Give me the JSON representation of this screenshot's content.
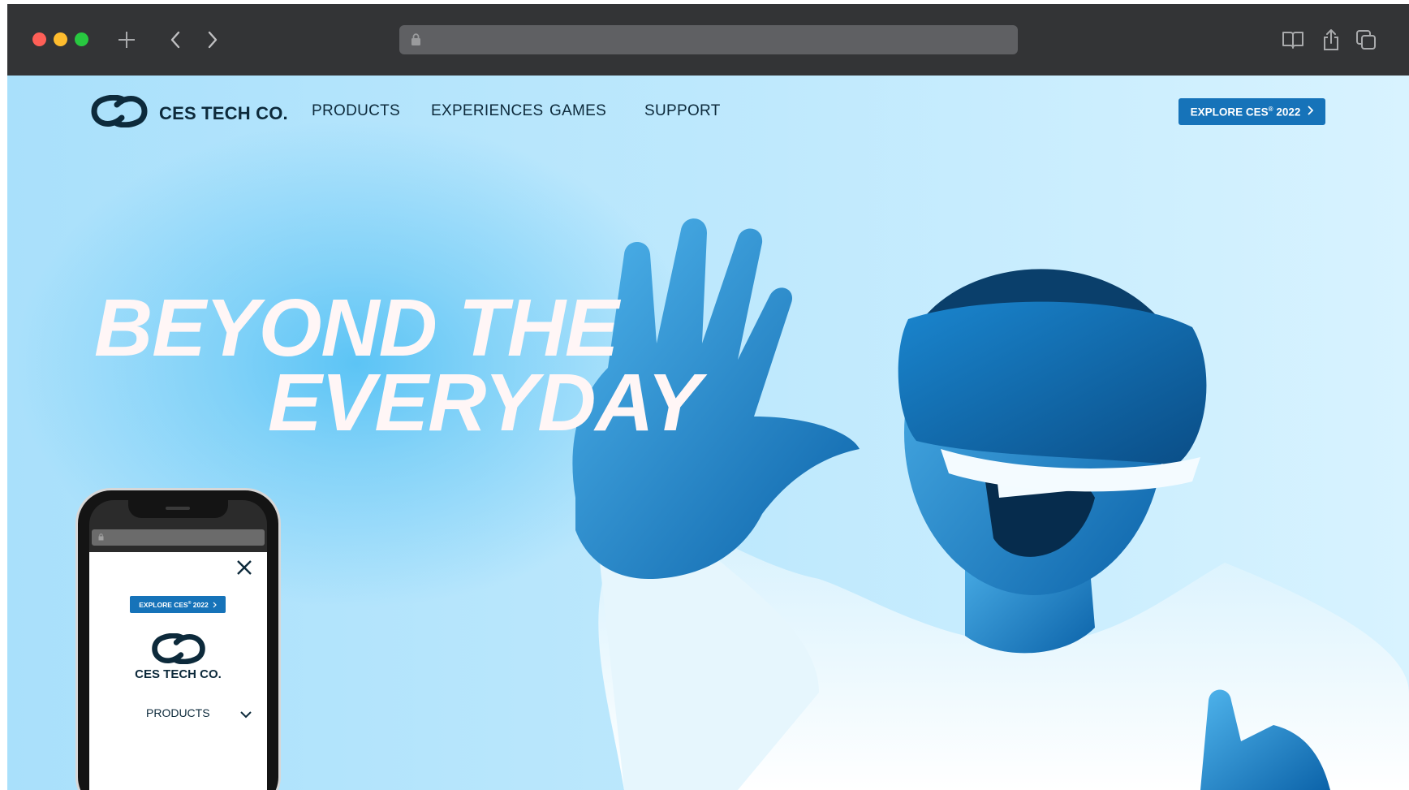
{
  "browser": {
    "toolbar_icons": [
      "close-dot",
      "minimize-dot",
      "zoom-dot",
      "new-tab-icon",
      "back-icon",
      "forward-icon",
      "lock-icon",
      "reader-icon",
      "share-icon",
      "tabs-overview-icon"
    ],
    "url": ""
  },
  "site": {
    "brand": "CES TECH CO.",
    "nav": [
      "PRODUCTS",
      "EXPERIENCES",
      "GAMES",
      "SUPPORT"
    ],
    "cta": {
      "label": "EXPLORE CES",
      "sup": "®",
      "year": "2022"
    },
    "headline": {
      "line1": "BEYOND THE",
      "line2": "EVERYDAY"
    }
  },
  "phone": {
    "cta": {
      "label": "EXPLORE CES",
      "sup": "®",
      "year": "2022"
    },
    "brand": "CES TECH CO.",
    "menu_item": "PRODUCTS"
  },
  "colors": {
    "accent": "#1673b9",
    "hero_background": "#aee4fb",
    "text_dark": "#0d2a3b",
    "headline": "#fff6f6"
  }
}
